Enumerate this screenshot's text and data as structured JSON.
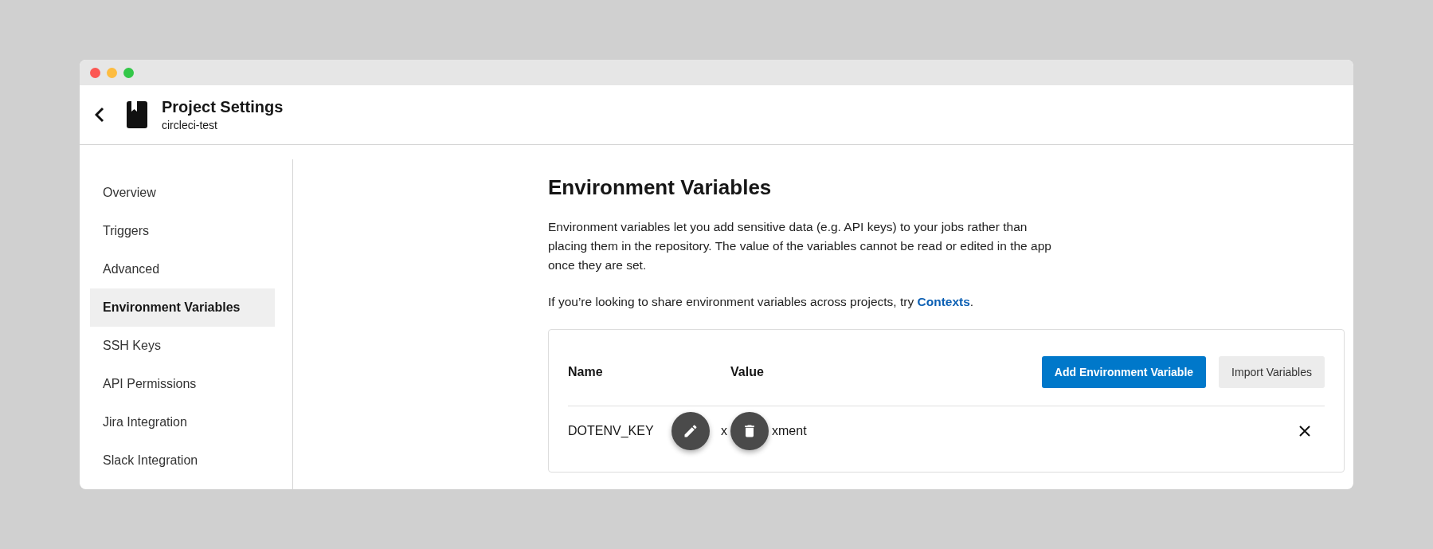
{
  "header": {
    "title": "Project Settings",
    "subtitle": "circleci-test"
  },
  "sidebar": {
    "items": [
      {
        "label": "Overview",
        "selected": false
      },
      {
        "label": "Triggers",
        "selected": false
      },
      {
        "label": "Advanced",
        "selected": false
      },
      {
        "label": "Environment Variables",
        "selected": true
      },
      {
        "label": "SSH Keys",
        "selected": false
      },
      {
        "label": "API Permissions",
        "selected": false
      },
      {
        "label": "Jira Integration",
        "selected": false
      },
      {
        "label": "Slack Integration",
        "selected": false
      }
    ]
  },
  "main": {
    "title": "Environment Variables",
    "description": "Environment variables let you add sensitive data (e.g. API keys) to your jobs rather than placing them in the repository. The value of the variables cannot be read or edited in the app once they are set.",
    "hint": "If you’re looking to share environment variables across projects, try ",
    "hint_link": "Contexts",
    "hint_end": "."
  },
  "table": {
    "columns": [
      "Name",
      "Value"
    ],
    "buttons": [
      {
        "label": "Add Environment Variable",
        "kind": "primary"
      },
      {
        "label": "Import Variables",
        "kind": "secondary"
      }
    ],
    "rows": [
      {
        "name": "DOTENV_KEY",
        "value_start": "x",
        "value_end": "xment"
      }
    ]
  }
}
